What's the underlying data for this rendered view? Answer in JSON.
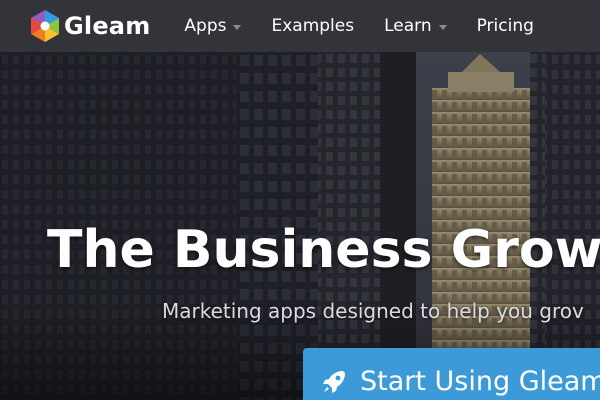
{
  "nav": {
    "brand": "Gleam",
    "items": [
      {
        "label": "Apps",
        "dropdown": true
      },
      {
        "label": "Examples",
        "dropdown": false
      },
      {
        "label": "Learn",
        "dropdown": true
      },
      {
        "label": "Pricing",
        "dropdown": false
      }
    ]
  },
  "hero": {
    "headline": "The Business Growt",
    "tagline": "Marketing apps designed to help you grov",
    "cta_label": "Start Using Gleam",
    "cta_icon": "rocket-icon"
  },
  "colors": {
    "nav_bg": "#333439",
    "cta_bg": "#3d9ad9",
    "text": "#ffffff",
    "tagline": "#dadbe0"
  }
}
